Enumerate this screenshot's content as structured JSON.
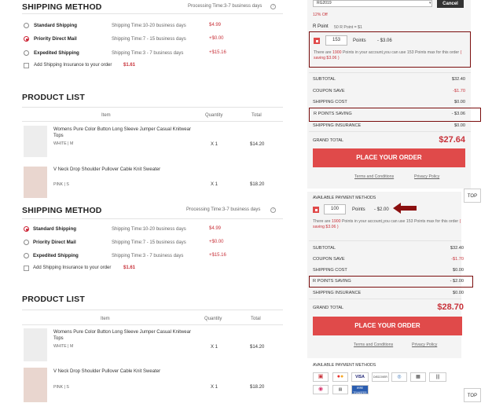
{
  "shipping": {
    "title": "SHIPPING METHOD",
    "processing_time": "Processing Time:3-7 business days",
    "options": [
      {
        "label": "Standard Shipping",
        "time": "Shipping Time:10-20 business days",
        "price": "$4.99"
      },
      {
        "label": "Priority Direct Mail",
        "time": "Shipping Time:7 - 15 business days",
        "price": "+$0.00"
      },
      {
        "label": "Expedited Shipping",
        "time": "Shipping Time:3 - 7 business days",
        "price": "+$15.16"
      }
    ],
    "insurance_label": "Add Shipping Insurance to your order",
    "insurance_price": "$1.61"
  },
  "products": {
    "title": "PRODUCT LIST",
    "headers": {
      "item": "Item",
      "quantity": "Quantity",
      "total": "Total"
    },
    "items": [
      {
        "name": "Womens Pure Color Button Long Sleeve Jumper Casual Knitwear Tops",
        "variant": "WHITE | M",
        "qty": "X 1",
        "total": "$14.20"
      },
      {
        "name": "V Neck Drop Shoulder Pullover Cable Knit Sweater",
        "variant": "PINK | S",
        "qty": "X 1",
        "total": "$18.20"
      }
    ]
  },
  "coupon": {
    "code": "RG2019",
    "cancel": "Cancel",
    "discount_note": "12% Off"
  },
  "rpoint": {
    "title": "R Point",
    "rate_note": "50 R Point = $1"
  },
  "panel_top": {
    "points_value": "153",
    "points_label": "Points",
    "points_saving": "- $3.06",
    "info_pre": "There are",
    "info_points": "1900",
    "info_mid": "Points in your account,you can use 153 Points max for this order",
    "info_saving": "( saving $3.06 )",
    "summary": [
      {
        "label": "SUBTOTAL",
        "value": "$32.40"
      },
      {
        "label": "COUPON SAVE",
        "value": "-$1.70"
      },
      {
        "label": "SHIPPING COST",
        "value": "$0.00"
      },
      {
        "label": "R POINTS SAVING",
        "value": "- $3.06"
      },
      {
        "label": "SHIPPING INSURANCE",
        "value": "$0.00"
      }
    ],
    "grand_total_label": "GRAND TOTAL",
    "grand_total_value": "$27.64",
    "place_order": "PLACE YOUR ORDER",
    "terms": "Terms and Conditions",
    "privacy": "Privacy Policy",
    "top": "TOP"
  },
  "panel_bottom": {
    "payment_methods_label": "AVAILABLE PAYMENT METHODS",
    "points_value": "100",
    "points_label": "Points",
    "points_saving": "- $2.00",
    "info_pre": "There are",
    "info_points": "1900",
    "info_mid": "Points in your account,you can use 153 Points max for this order",
    "info_saving": "( saving $3.06 )",
    "summary": [
      {
        "label": "SUBTOTAL",
        "value": "$32.40"
      },
      {
        "label": "COUPON SAVE",
        "value": "-$1.70"
      },
      {
        "label": "SHIPPING COST",
        "value": "$0.00"
      },
      {
        "label": "R POINTS SAVING",
        "value": "- $2.00"
      },
      {
        "label": "SHIPPING INSURANCE",
        "value": "$0.00"
      }
    ],
    "grand_total_label": "GRAND TOTAL",
    "grand_total_value": "$28.70",
    "place_order": "PLACE YOUR ORDER",
    "terms": "Terms and Conditions",
    "privacy": "Privacy Policy",
    "payment_methods_label2": "AVAILABLE PAYMENT METHODS",
    "payments": [
      "VISA",
      "DISCOVER",
      "WIRE TRANSFER"
    ],
    "top": "TOP"
  },
  "colors": {
    "accent": "#e04a4a",
    "highlight_border": "#7a0d0d",
    "red_text": "#c8323a"
  }
}
